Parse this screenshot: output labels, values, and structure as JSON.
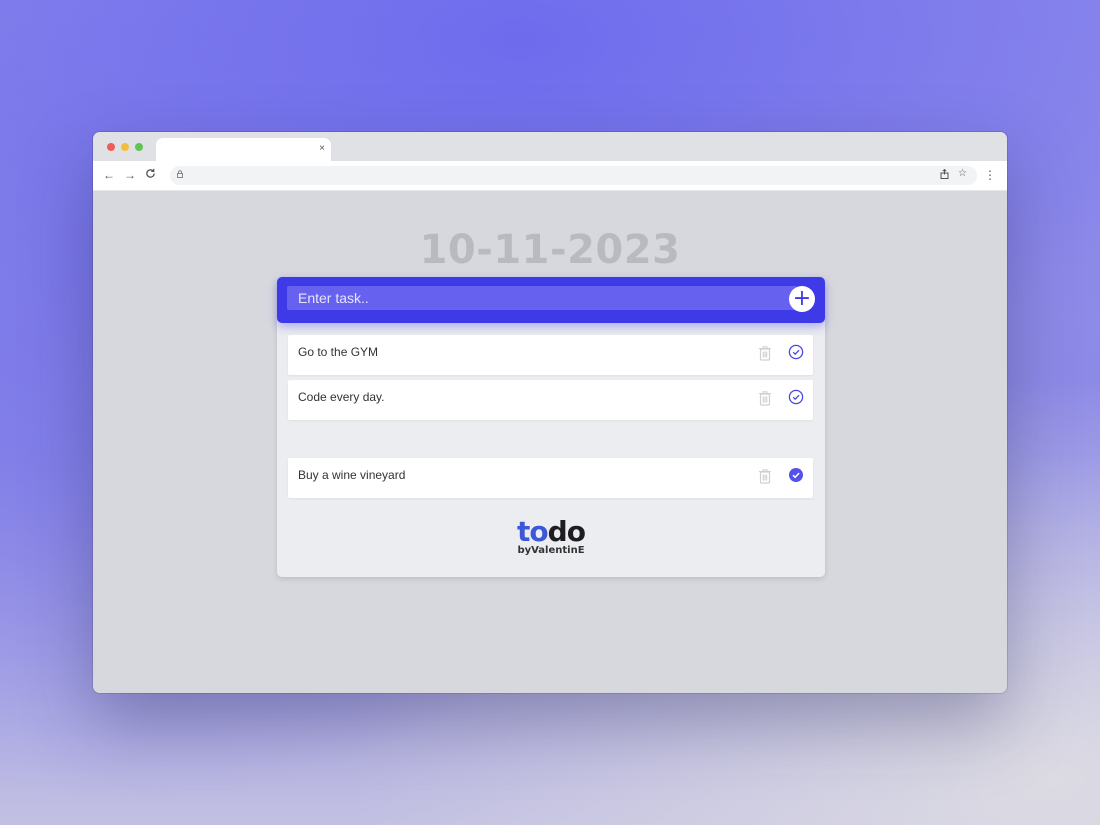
{
  "browser": {
    "tab_close": "×",
    "nav_back": "←",
    "nav_forward": "→",
    "nav_reload": "C",
    "lock_icon": "lock-icon",
    "menu": "⋮"
  },
  "app": {
    "date": "10-11-2023",
    "input_placeholder": "Enter task..",
    "add_label": "+",
    "accent_color": "#3e3ae8",
    "tasks": [
      {
        "text": "Go to the GYM",
        "done": false
      },
      {
        "text": "Code every day.",
        "done": false
      },
      {
        "text": "Buy a wine vineyard",
        "done": true
      }
    ],
    "logo_to": "to",
    "logo_do": "do",
    "byline": "byValentinE"
  }
}
